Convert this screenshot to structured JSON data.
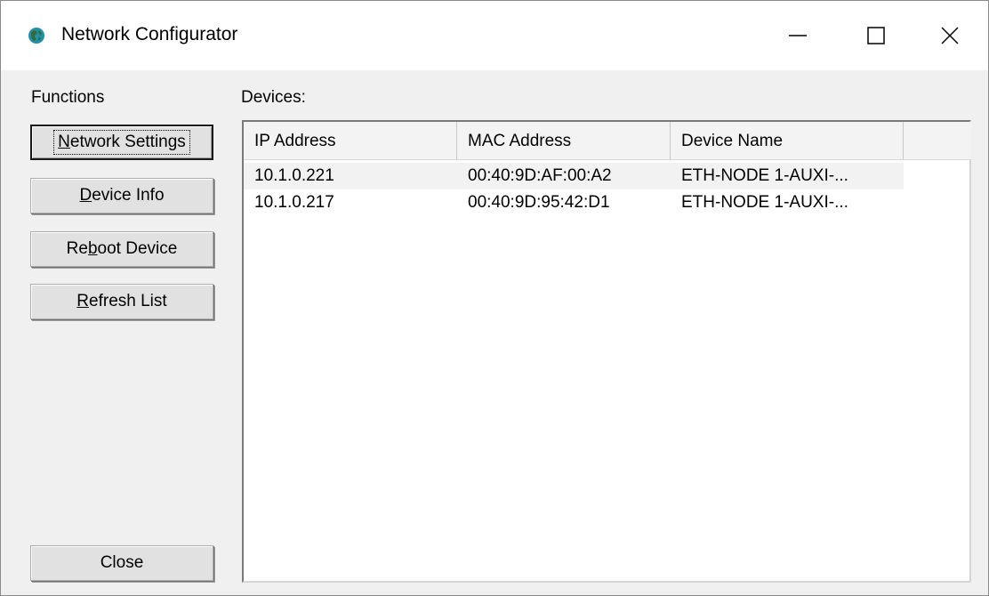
{
  "window": {
    "title": "Network Configurator",
    "app_icon": "globe-icon",
    "caption_icons": [
      "minimize-icon",
      "maximize-icon",
      "close-icon"
    ]
  },
  "functions": {
    "label": "Functions",
    "buttons": [
      {
        "pre": "",
        "accel": "N",
        "post": "etwork Settings"
      },
      {
        "pre": "",
        "accel": "D",
        "post": "evice Info"
      },
      {
        "pre": "Re",
        "accel": "b",
        "post": "oot Device"
      },
      {
        "pre": "",
        "accel": "R",
        "post": "efresh List"
      }
    ],
    "close_label": "Close"
  },
  "devices": {
    "label": "Devices:",
    "columns": [
      "IP Address",
      "MAC Address",
      "Device Name"
    ],
    "rows": [
      {
        "ip": "10.1.0.221",
        "mac": "00:40:9D:AF:00:A2",
        "name": "ETH-NODE 1-AUXI-..."
      },
      {
        "ip": "10.1.0.217",
        "mac": "00:40:9D:95:42:D1",
        "name": "ETH-NODE 1-AUXI-..."
      }
    ]
  }
}
